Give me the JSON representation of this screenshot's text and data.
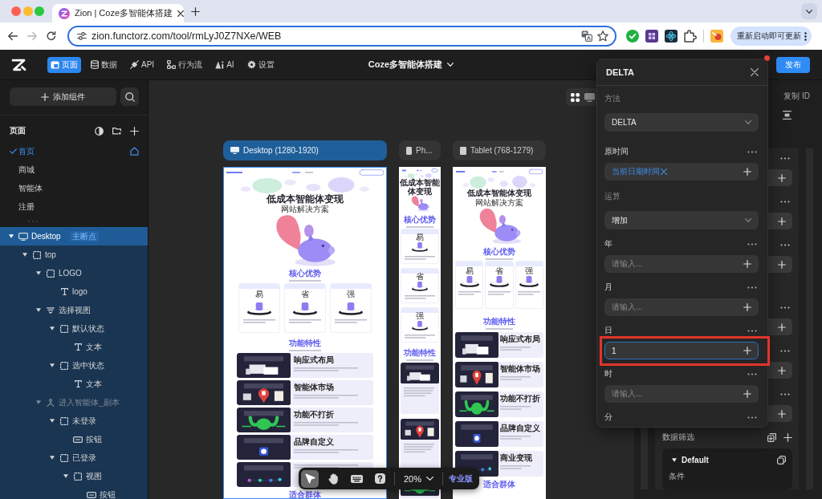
{
  "browser": {
    "tab_title": "Zion | Coze多智能体搭建",
    "url": "zion.functorz.com/tool/rmLyJ0Z7NXe/WEB",
    "update_button": "重新启动即可更新"
  },
  "toolbar": {
    "nav": [
      {
        "kind": "page",
        "label": "页面",
        "selected": true
      },
      {
        "kind": "data",
        "label": "数据",
        "selected": false
      },
      {
        "kind": "api",
        "label": "API",
        "selected": false
      },
      {
        "kind": "flow",
        "label": "行为流",
        "selected": false
      },
      {
        "kind": "ai",
        "label": "AI",
        "selected": false
      },
      {
        "kind": "settings",
        "label": "设置",
        "selected": false
      }
    ],
    "title": "Coze多智能体搭建",
    "notification": true,
    "publish": "发布"
  },
  "sidebar": {
    "add_button": "添加组件",
    "pages_title": "页面",
    "pages": [
      {
        "label": "首页",
        "selected": true,
        "home": true
      },
      {
        "label": "商城",
        "selected": false,
        "home": false
      },
      {
        "label": "智能体",
        "selected": false,
        "home": false
      },
      {
        "label": "注册",
        "selected": false,
        "home": false
      }
    ],
    "tree": [
      {
        "kind": "screen",
        "label": "Desktop",
        "badge": "主断点",
        "selected": true,
        "disabled": false,
        "expanded": true,
        "children": [
          {
            "kind": "frame",
            "label": "top",
            "selected": false,
            "disabled": false,
            "expanded": true,
            "children": [
              {
                "kind": "frame",
                "label": "LOGO",
                "selected": false,
                "disabled": false,
                "expanded": true,
                "children": [
                  {
                    "kind": "text",
                    "label": "logo",
                    "selected": false,
                    "disabled": false
                  }
                ]
              },
              {
                "kind": "switch",
                "label": "选择视图",
                "selected": false,
                "disabled": false,
                "expanded": true,
                "children": [
                  {
                    "kind": "frame",
                    "label": "默认状态",
                    "selected": false,
                    "disabled": false,
                    "expanded": true,
                    "children": [
                      {
                        "kind": "text",
                        "label": "文本",
                        "selected": false,
                        "disabled": false
                      }
                    ]
                  },
                  {
                    "kind": "frame",
                    "label": "选中状态",
                    "selected": false,
                    "disabled": false,
                    "expanded": true,
                    "children": [
                      {
                        "kind": "text",
                        "label": "文本",
                        "selected": false,
                        "disabled": false
                      }
                    ]
                  }
                ]
              },
              {
                "kind": "component",
                "label": "进入智能体_副本",
                "selected": false,
                "disabled": true,
                "expanded": true,
                "children": [
                  {
                    "kind": "frame",
                    "label": "未登录",
                    "selected": false,
                    "disabled": false,
                    "expanded": true,
                    "children": [
                      {
                        "kind": "button",
                        "label": "按钮",
                        "selected": false,
                        "disabled": false
                      }
                    ]
                  },
                  {
                    "kind": "frame",
                    "label": "已登录",
                    "selected": false,
                    "disabled": false,
                    "expanded": true,
                    "children": [
                      {
                        "kind": "frame",
                        "label": "视图",
                        "selected": false,
                        "disabled": false,
                        "expanded": true,
                        "children": [
                          {
                            "kind": "button",
                            "label": "按钮",
                            "selected": false,
                            "disabled": false
                          }
                        ]
                      }
                    ]
                  }
                ]
              }
            ]
          }
        ]
      }
    ]
  },
  "canvas": {
    "view_modes": [
      {
        "kind": "grid",
        "selected": true
      },
      {
        "kind": "screen",
        "selected": false
      }
    ],
    "breakpoints": [
      {
        "kind": "desktop",
        "label": "Desktop (1280-1920)",
        "selected": true,
        "preview": {
          "title": "低成本智能体变现",
          "subtitle": "网站解决方案",
          "advantages_title": "核心优势",
          "cards": [
            "易",
            "省",
            "强"
          ],
          "features_title": "功能特性",
          "features": [
            {
              "kind": "screens",
              "title": "响应式布局"
            },
            {
              "kind": "pin",
              "title": "智能体市场"
            },
            {
              "kind": "muscle",
              "title": "功能不打折"
            },
            {
              "kind": "tile",
              "title": "品牌自定义"
            },
            {
              "kind": "dots"
            }
          ],
          "audience_title": "适合群体"
        }
      },
      {
        "kind": "phone",
        "label": "Ph...",
        "selected": false,
        "preview": {
          "title": "低成本智能体变现",
          "advantages_title": "核心优势",
          "cards": [
            "易",
            "省",
            "强"
          ],
          "features_title": "功能特性",
          "features": [
            {
              "kind": "screens"
            },
            {
              "kind": "pin"
            },
            {
              "kind": "muscle"
            }
          ]
        }
      },
      {
        "kind": "tablet",
        "label": "Tablet (768-1279)",
        "selected": false,
        "preview": {
          "title": "低成本智能体变现",
          "subtitle": "网站解决方案",
          "advantages_title": "核心优势",
          "cards": [
            "易",
            "省",
            "强"
          ],
          "features_title": "功能特性",
          "features": [
            {
              "kind": "screens",
              "title": "响应式布局"
            },
            {
              "kind": "pin",
              "title": "智能体市场"
            },
            {
              "kind": "muscle",
              "title": "功能不打折"
            },
            {
              "kind": "tile",
              "title": "品牌自定义"
            },
            {
              "kind": "dots",
              "title": "商业变现"
            }
          ],
          "audience_title": "适合群体"
        }
      }
    ],
    "tools": [
      {
        "kind": "pointer",
        "selected": true
      },
      {
        "kind": "hand",
        "selected": false
      },
      {
        "kind": "keyboard",
        "selected": false
      },
      {
        "kind": "help",
        "selected": false
      }
    ],
    "zoom": "20%",
    "edition": "专业版"
  },
  "properties": {
    "copy_id": "复制 ID",
    "param_groups": [
      {
        "rows": [
          {
            "kind": "field"
          },
          {
            "kind": "field"
          },
          {
            "kind": "field"
          }
        ]
      },
      {
        "rows": [
          {
            "kind": "field"
          },
          {
            "kind": "field"
          },
          {
            "kind": "field"
          }
        ]
      }
    ],
    "filter_title": "数据筛选",
    "filter_cards": [
      {
        "title": "Default",
        "expanded": true,
        "condition_label": "条件"
      }
    ]
  },
  "delta_popover": {
    "title": "DELTA",
    "items": [
      {
        "kind": "select",
        "label": "方法",
        "value": "DELTA",
        "more": false,
        "focused": false,
        "highlighted": false
      },
      {
        "kind": "token",
        "label": "原时间",
        "token": "当前日期时间",
        "more": true,
        "focused": false,
        "highlighted": false
      },
      {
        "kind": "select",
        "label": "运算",
        "value": "增加",
        "more": false,
        "focused": false,
        "highlighted": false
      },
      {
        "kind": "field",
        "label": "年",
        "placeholder": "请输入...",
        "more": true,
        "focused": false,
        "highlighted": false
      },
      {
        "kind": "field",
        "label": "月",
        "placeholder": "请输入...",
        "more": true,
        "focused": false,
        "highlighted": false
      },
      {
        "kind": "field",
        "label": "日",
        "value": "1",
        "more": true,
        "focused": true,
        "highlighted": true
      },
      {
        "kind": "field",
        "label": "时",
        "placeholder": "请输入...",
        "more": true,
        "focused": false,
        "highlighted": false
      },
      {
        "kind": "label",
        "label": "分",
        "more": true,
        "focused": false,
        "highlighted": false
      }
    ]
  }
}
